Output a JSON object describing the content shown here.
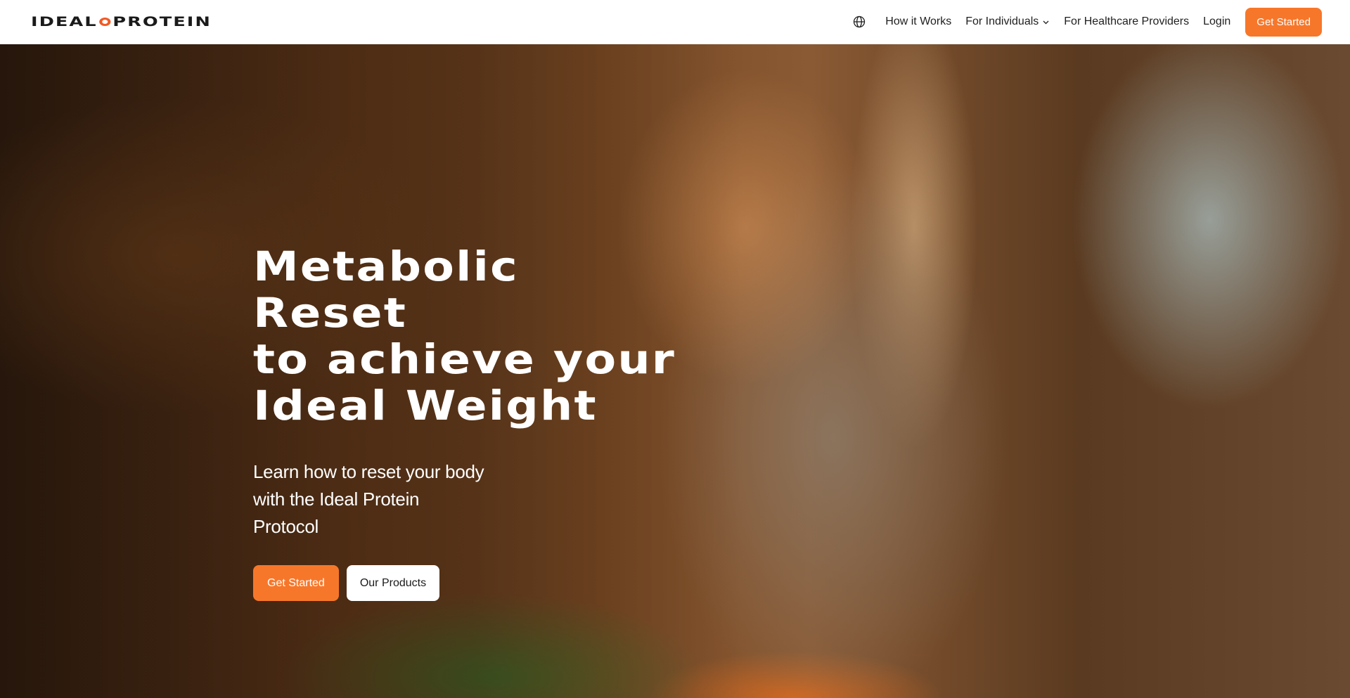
{
  "header": {
    "logo_left": "IDEAL",
    "logo_right": "PROTEIN",
    "nav": {
      "globe_icon": "globe-icon",
      "how_it_works": "How it Works",
      "for_individuals": "For Individuals",
      "for_providers": "For Healthcare Providers",
      "login": "Login",
      "get_started": "Get Started"
    }
  },
  "hero": {
    "title": "Metabolic Reset\nto achieve your\nIdeal Weight",
    "subtitle": "Learn how to reset your body with the Ideal Protein Protocol",
    "primary_button": "Get Started",
    "secondary_button": "Our Products"
  },
  "colors": {
    "accent": "#f7772a",
    "logo_dot": "#f15a24",
    "text_dark": "#1f1f1f"
  }
}
